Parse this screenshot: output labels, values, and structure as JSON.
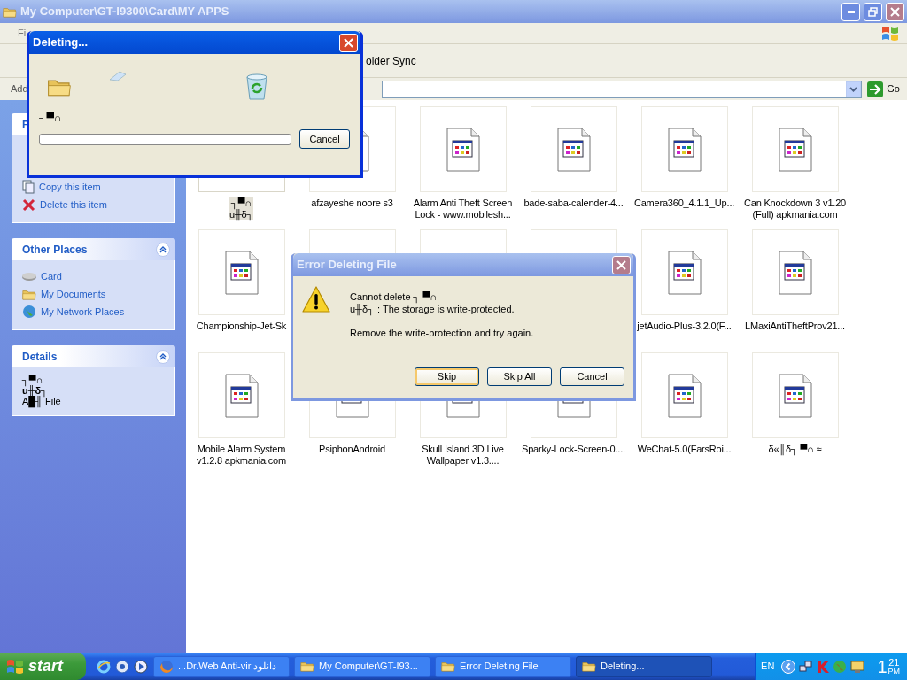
{
  "window": {
    "title": "My Computer\\GT-I9300\\Card\\MY APPS",
    "active": false
  },
  "menu_bar": {
    "visible_text": "Fi"
  },
  "toolbar": {
    "visible_text": "older Sync"
  },
  "address_bar": {
    "label": "Add",
    "go": "Go"
  },
  "task_pane": [
    {
      "title": "F",
      "expanded": true,
      "items": [
        "Copy this item",
        "Delete this item"
      ]
    },
    {
      "title": "Other Places",
      "expanded": true,
      "items": [
        "Card",
        "My Documents",
        "My Network Places"
      ]
    },
    {
      "title": "Details",
      "expanded": true,
      "lines": [
        "┐▀∩",
        "u╫δ┐",
        "A█╢ File"
      ]
    }
  ],
  "files": [
    {
      "lines": [
        "┐▀∩",
        "u╫δ┐"
      ],
      "selected": true
    },
    {
      "lines": [
        "afzayeshe noore s3"
      ],
      "selected": false
    },
    {
      "lines": [
        "Alarm Anti Theft Screen",
        "Lock - www.mobilesh..."
      ],
      "selected": false
    },
    {
      "lines": [
        "bade-saba-calender-4..."
      ],
      "selected": false
    },
    {
      "lines": [
        "Camera360_4.1.1_Up..."
      ],
      "selected": false
    },
    {
      "lines": [
        "Can Knockdown 3 v1.20",
        "(Full) apkmania.com"
      ],
      "selected": false
    },
    {
      "lines": [
        "Championship-Jet-Sk"
      ],
      "selected": false
    },
    {
      "selected": false
    },
    {
      "selected": false
    },
    {
      "selected": false
    },
    {
      "lines": [
        "jetAudio-Plus-3.2.0(F..."
      ],
      "selected": false
    },
    {
      "lines": [
        "LMaxiAntiTheftProv21..."
      ],
      "selected": false
    },
    {
      "lines": [
        "Mobile Alarm System",
        "v1.2.8 apkmania.com"
      ],
      "selected": false
    },
    {
      "lines": [
        "PsiphonAndroid"
      ],
      "selected": false
    },
    {
      "lines": [
        "Skull Island 3D Live",
        "Wallpaper v1.3...."
      ],
      "selected": false
    },
    {
      "lines": [
        "Sparky-Lock-Screen-0...."
      ],
      "selected": false
    },
    {
      "lines": [
        "WeChat-5.0(FarsRoi..."
      ],
      "selected": false
    },
    {
      "lines": [
        "δ«║δ┐ ▀∩ ≈"
      ],
      "selected": false
    }
  ],
  "deleting_dialog": {
    "title": "Deleting...",
    "active": true,
    "file_name": "┐▀∩",
    "level": 0,
    "button": "Cancel"
  },
  "error_dialog": {
    "title": "Error Deleting File",
    "active": false,
    "message_lines": [
      "Cannot delete ┐ ▀∩",
      "u╫δ┐ : The storage is write-protected."
    ],
    "hint": "Remove the write-protection and try again.",
    "buttons": [
      {
        "label": "Skip",
        "default": true
      },
      {
        "label": "Skip All",
        "default": false
      },
      {
        "label": "Cancel",
        "default": false
      }
    ]
  },
  "taskbar": {
    "start": "start",
    "tasks": [
      {
        "label": "دانلود Dr.Web Anti-vir...",
        "selected": false
      },
      {
        "label": "My Computer\\GT-I93...",
        "selected": false
      },
      {
        "label": "Error Deleting File",
        "selected": false
      },
      {
        "label": "Deleting...",
        "selected": true
      }
    ],
    "language": "EN",
    "clock": {
      "hour": "1",
      "minute": "21",
      "ampm": "PM"
    }
  }
}
